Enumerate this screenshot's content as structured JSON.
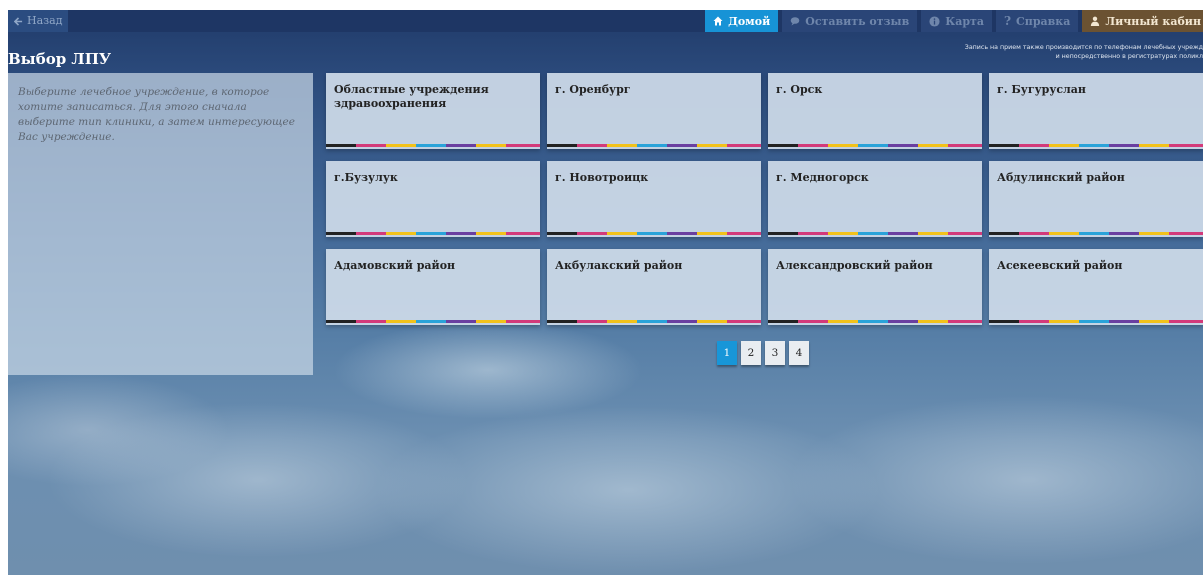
{
  "nav": {
    "back_label": "Назад",
    "items": [
      {
        "label": "Домой",
        "icon": "home-icon"
      },
      {
        "label": "Оставить отзыв",
        "icon": "comment-icon"
      },
      {
        "label": "Карта",
        "icon": "info-icon"
      },
      {
        "label": "Справка",
        "icon": "question-icon"
      },
      {
        "label": "Личный кабин",
        "icon": "user-icon"
      }
    ]
  },
  "page": {
    "title": "Выбор ЛПУ",
    "note_line1": "Запись на прием также производится по телефонам лечебных учрежд",
    "note_line2": "и непосредственно в регистратурах поликл",
    "instructions": "Выберите лечебное учреждение, в которое хотите записаться. Для этого сначала выберите тип клиники, а затем интересующее Вас учреждение."
  },
  "cards": [
    "Областные учреждения здравоохранения",
    "г. Оренбург",
    "г. Орск",
    "г. Бугуруслан",
    "г.Бузулук",
    "г. Новотроицк",
    "г. Медногорск",
    "Абдулинский район",
    "Адамовский район",
    "Акбулакский район",
    "Александровский район",
    "Асекеевский район"
  ],
  "pagination": {
    "pages": [
      "1",
      "2",
      "3",
      "4"
    ],
    "current": "1"
  },
  "colors": {
    "home_active": "#1793d6",
    "cabinet": "#6b5232",
    "topbar": "#1e3664"
  }
}
